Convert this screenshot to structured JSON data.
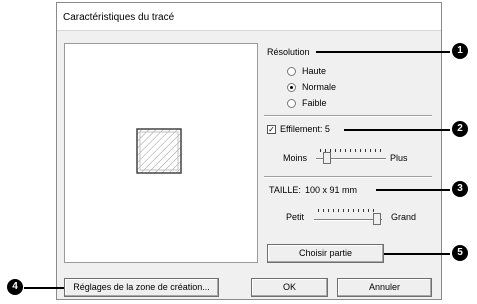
{
  "dialog": {
    "title": "Caractéristiques du tracé"
  },
  "resolution": {
    "label": "Résolution",
    "options": [
      "Haute",
      "Normale",
      "Faible"
    ],
    "selected": "Normale"
  },
  "effilement": {
    "label": "Effilement: 5",
    "checked": true,
    "min_label": "Moins",
    "max_label": "Plus",
    "value": 5
  },
  "taille": {
    "label": "TAILLE:",
    "value": "100 x 91 mm",
    "min_label": "Petit",
    "max_label": "Grand"
  },
  "buttons": {
    "choose_part": "Choisir partie",
    "settings_zone": "Réglages de la zone de création...",
    "ok": "OK",
    "cancel": "Annuler"
  },
  "callouts": {
    "c1": "1",
    "c2": "2",
    "c3": "3",
    "c4": "4",
    "c5": "5"
  }
}
